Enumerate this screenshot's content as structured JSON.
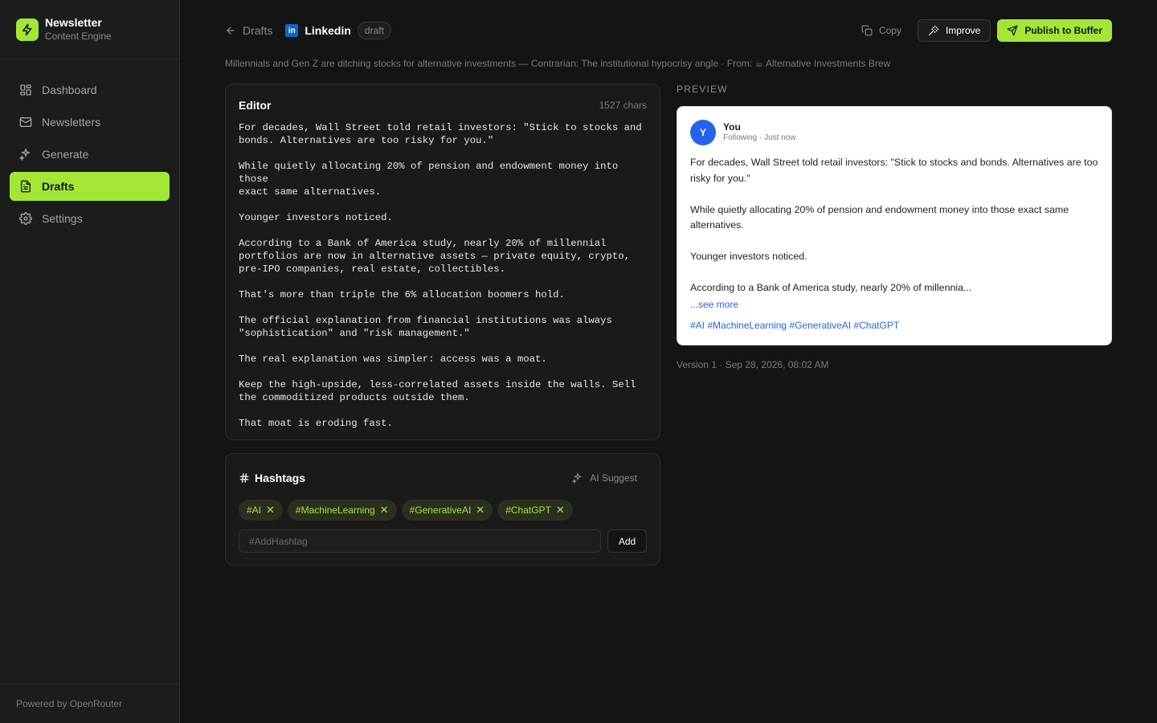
{
  "brand": {
    "title": "Newsletter",
    "subtitle": "Content Engine"
  },
  "sidebar": {
    "items": [
      {
        "label": "Dashboard",
        "icon": "dashboard-icon"
      },
      {
        "label": "Newsletters",
        "icon": "mail-icon"
      },
      {
        "label": "Generate",
        "icon": "sparkles-icon"
      },
      {
        "label": "Drafts",
        "icon": "file-text-icon",
        "active": true
      },
      {
        "label": "Settings",
        "icon": "gear-icon"
      }
    ],
    "footer": "Powered by OpenRouter"
  },
  "header": {
    "back_label": "Drafts",
    "platform": "Linkedin",
    "status": "draft",
    "copy_label": "Copy",
    "improve_label": "Improve",
    "publish_label": "Publish to Buffer"
  },
  "subtitle": "Millennials and Gen Z are ditching stocks for alternative investments — Contrarian: The institutional hypocrisy angle · From: ☕ Alternative Investments Brew",
  "editor": {
    "title": "Editor",
    "char_count": "1527 chars",
    "content": "For decades, Wall Street told retail investors: \"Stick to stocks and\nbonds. Alternatives are too risky for you.\"\n\nWhile quietly allocating 20% of pension and endowment money into those\nexact same alternatives.\n\nYounger investors noticed.\n\nAccording to a Bank of America study, nearly 20% of millennial\nportfolios are now in alternative assets — private equity, crypto,\npre-IPO companies, real estate, collectibles.\n\nThat's more than triple the 6% allocation boomers hold.\n\nThe official explanation from financial institutions was always\n\"sophistication\" and \"risk management.\"\n\nThe real explanation was simpler: access was a moat.\n\nKeep the high-upside, less-correlated assets inside the walls. Sell\nthe commoditized products outside them.\n\nThat moat is eroding fast."
  },
  "hashtags": {
    "title": "Hashtags",
    "ai_suggest_label": "AI Suggest",
    "tags": [
      "#AI",
      "#MachineLearning",
      "#GenerativeAI",
      "#ChatGPT"
    ],
    "input_placeholder": "#AddHashtag",
    "add_label": "Add"
  },
  "preview": {
    "label": "PREVIEW",
    "avatar_letter": "Y",
    "author": "You",
    "meta": "Following · Just now",
    "body": "For decades, Wall Street told retail investors: \"Stick to stocks and bonds. Alternatives are too risky for you.\"\n\nWhile quietly allocating 20% of pension and endowment money into those exact same alternatives.\n\nYounger investors noticed.\n\nAccording to a Bank of America study, nearly 20% of millennia...",
    "see_more": "...see more",
    "tags_line": "#AI #MachineLearning #GenerativeAI #ChatGPT"
  },
  "version": "Version 1 · Sep 28, 2026, 08:02 AM",
  "colors": {
    "accent": "#a3e635",
    "link": "#2563eb",
    "background": "#141414",
    "linkedin": "#0a66c2"
  }
}
